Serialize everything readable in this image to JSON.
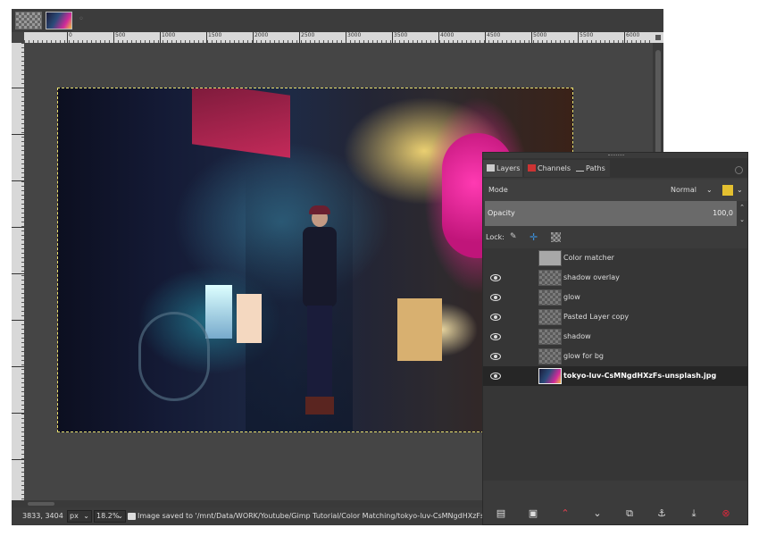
{
  "image_tabs": [
    {
      "name": "image-tab-1"
    },
    {
      "name": "image-tab-2"
    }
  ],
  "ruler": {
    "labels": [
      "0",
      "500",
      "1000",
      "1500",
      "2000",
      "2500",
      "3000",
      "3500",
      "4000",
      "4500",
      "5000",
      "5500",
      "6000"
    ]
  },
  "status": {
    "coords": "3833, 3404",
    "unit": "px",
    "zoom": "18.2%",
    "message": "Image saved to '/mnt/Data/WORK/Youtube/Gimp Tutorial/Color Matching/tokyo-luv-CsMNgdHXzFs-unsplash.xcf'"
  },
  "dock": {
    "tabs": [
      {
        "label": "Layers",
        "icon": "layers-icon"
      },
      {
        "label": "Channels",
        "icon": "channels-icon"
      },
      {
        "label": "Paths",
        "icon": "paths-icon"
      }
    ],
    "mode_label": "Mode",
    "mode_value": "Normal",
    "opacity_label": "Opacity",
    "opacity_value": "100,0",
    "lock_label": "Lock:",
    "layers": [
      {
        "name": "Color matcher",
        "visible": false
      },
      {
        "name": "shadow overlay",
        "visible": true
      },
      {
        "name": "glow",
        "visible": true
      },
      {
        "name": "Pasted Layer copy",
        "visible": true
      },
      {
        "name": "shadow",
        "visible": true
      },
      {
        "name": "glow for bg",
        "visible": true
      },
      {
        "name": "tokyo-luv-CsMNgdHXzFs-unsplash.jpg",
        "visible": true,
        "selected": true
      }
    ],
    "tools": [
      "new-layer-icon",
      "new-layer-group-icon",
      "raise-layer-icon",
      "lower-layer-icon",
      "duplicate-layer-icon",
      "anchor-layer-icon",
      "merge-layer-icon",
      "delete-layer-icon"
    ]
  },
  "colors": {
    "accent_delete": "#d9283c",
    "raise": "#e64050",
    "selection": "#e8e070"
  }
}
